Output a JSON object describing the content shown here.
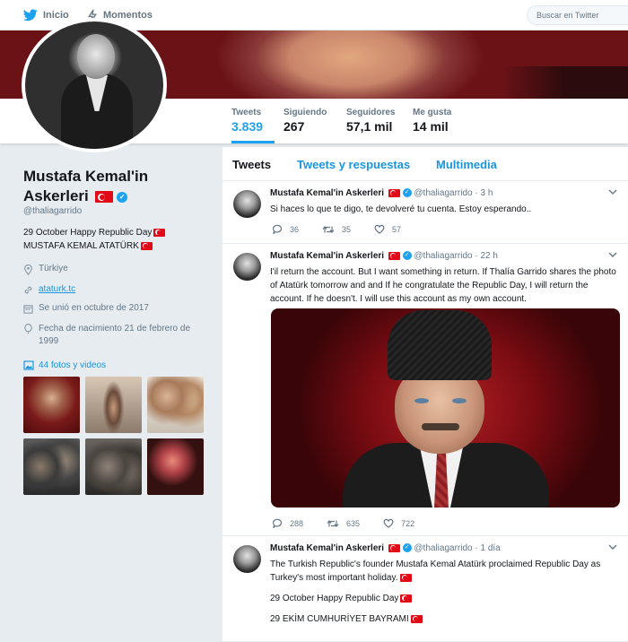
{
  "nav": {
    "home_label": "Inicio",
    "moments_label": "Momentos",
    "search_placeholder": "Buscar en Twitter"
  },
  "profile": {
    "name": "Mustafa Kemal'in Askerleri",
    "handle": "@thaliagarrido",
    "bio_line1": "29 October Happy Republic Day",
    "bio_line2": "MUSTAFA KEMAL ATATÜRK",
    "location": "Türkiye",
    "url": "ataturk.tc",
    "joined": "Se unió en octubre de 2017",
    "birth": "Fecha de nacimiento 21 de febrero de 1999",
    "photos_link": "44 fotos y videos"
  },
  "stats": [
    {
      "label": "Tweets",
      "value": "3.839"
    },
    {
      "label": "Siguiendo",
      "value": "267"
    },
    {
      "label": "Seguidores",
      "value": "57,1 mil"
    },
    {
      "label": "Me gusta",
      "value": "14 mil"
    }
  ],
  "tabs": {
    "tweets": "Tweets",
    "replies": "Tweets y respuestas",
    "media": "Multimedia"
  },
  "tweets": [
    {
      "name": "Mustafa Kemal'in Askerleri",
      "handle": "@thaliagarrido",
      "time": "· 3 h",
      "text": "Si haces lo que te digo, te devolveré tu cuenta. Estoy esperando..",
      "replies": "36",
      "retweets": "35",
      "likes": "57"
    },
    {
      "name": "Mustafa Kemal'in Askerleri",
      "handle": "@thaliagarrido",
      "time": "· 22 h",
      "text": "I'il return the account. But I want something in return. If Thalía Garrido shares the photo of Atatürk tomorrow and and If he congratulate the Republic Day, I will return the account. If he doesn't. I will use this account as my own account.",
      "replies": "288",
      "retweets": "635",
      "likes": "722"
    },
    {
      "name": "Mustafa Kemal'in Askerleri",
      "handle": "@thaliagarrido",
      "time": "· 1 día",
      "text": "The Turkish Republic's founder Mustafa Kemal Atatürk proclaimed Republic Day as Turkey's most important holiday.",
      "line2": "29 October Happy Republic Day",
      "line3": "29 EKİM CUMHURİYET BAYRAMI"
    }
  ],
  "colors": {
    "accent": "#1da1f2",
    "link": "#1b95e0",
    "background": "#e6ecf0",
    "flag_red": "#e30a17"
  },
  "icons": [
    "twitter-bird-icon",
    "lightning-icon",
    "location-icon",
    "link-icon",
    "calendar-icon",
    "balloon-icon",
    "photo-icon",
    "verified-icon",
    "turkish-flag-icon",
    "reply-icon",
    "retweet-icon",
    "like-icon",
    "chevron-down-icon"
  ]
}
